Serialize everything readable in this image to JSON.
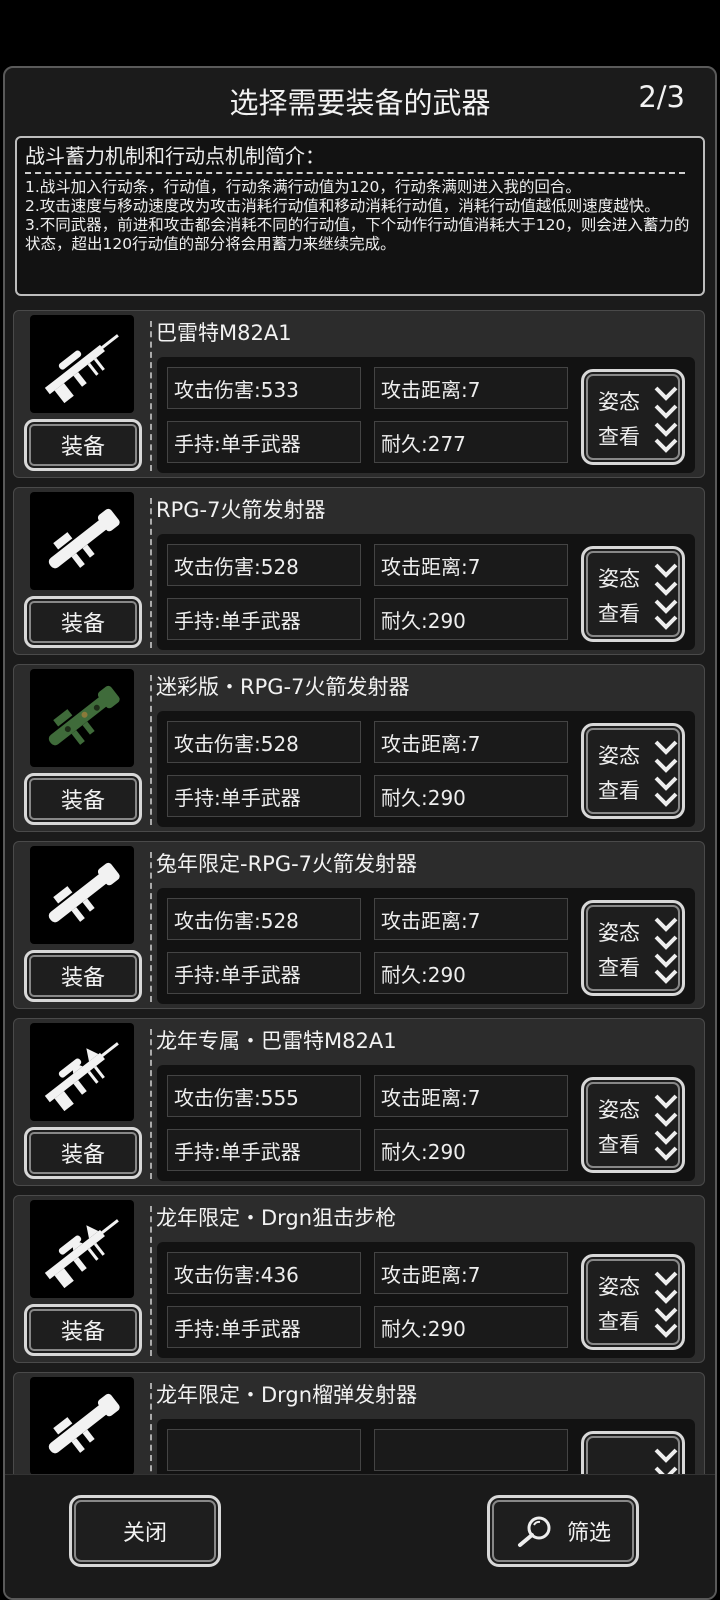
{
  "header": {
    "title": "选择需要装备的武器",
    "page": "2/3"
  },
  "intro": {
    "title": "战斗蓄力机制和行动点机制简介：",
    "lines": [
      "1.战斗加入行动条，行动值，行动条满行动值为120，行动条满则进入我的回合。",
      "2.攻击速度与移动速度改为攻击消耗行动值和移动消耗行动值，消耗行动值越低则速度越快。",
      "3.不同武器，前进和攻击都会消耗不同的行动值，下个动作行动值消耗大于120，则会进入蓄力的状态，超出120行动值的部分将会用蓄力来继续完成。"
    ]
  },
  "weapons": [
    {
      "name": "巴雷特M82A1",
      "damage": "攻击伤害:533",
      "range": "攻击距离:7",
      "hold": "手持:单手武器",
      "durability": "耐久:277",
      "equip": "装备",
      "posture1": "姿态",
      "posture2": "查看",
      "icon": "sniper-rifle-icon"
    },
    {
      "name": "RPG-7火箭发射器",
      "damage": "攻击伤害:528",
      "range": "攻击距离:7",
      "hold": "手持:单手武器",
      "durability": "耐久:290",
      "equip": "装备",
      "posture1": "姿态",
      "posture2": "查看",
      "icon": "rocket-launcher-icon"
    },
    {
      "name": "迷彩版・RPG-7火箭发射器",
      "damage": "攻击伤害:528",
      "range": "攻击距离:7",
      "hold": "手持:单手武器",
      "durability": "耐久:290",
      "equip": "装备",
      "posture1": "姿态",
      "posture2": "查看",
      "icon": "camo-rocket-launcher-icon"
    },
    {
      "name": "兔年限定-RPG-7火箭发射器",
      "damage": "攻击伤害:528",
      "range": "攻击距离:7",
      "hold": "手持:单手武器",
      "durability": "耐久:290",
      "equip": "装备",
      "posture1": "姿态",
      "posture2": "查看",
      "icon": "rabbit-rocket-launcher-icon"
    },
    {
      "name": "龙年专属・巴雷特M82A1",
      "damage": "攻击伤害:555",
      "range": "攻击距离:7",
      "hold": "手持:单手武器",
      "durability": "耐久:290",
      "equip": "装备",
      "posture1": "姿态",
      "posture2": "查看",
      "icon": "dragon-sniper-rifle-icon"
    },
    {
      "name": "龙年限定・Drgn狙击步枪",
      "damage": "攻击伤害:436",
      "range": "攻击距离:7",
      "hold": "手持:单手武器",
      "durability": "耐久:290",
      "equip": "装备",
      "posture1": "姿态",
      "posture2": "查看",
      "icon": "dragon-sniper-icon"
    },
    {
      "name": "龙年限定・Drgn榴弹发射器",
      "damage": "",
      "range": "",
      "hold": "",
      "durability": "",
      "equip": "",
      "posture1": "",
      "posture2": "",
      "icon": "dragon-grenade-launcher-icon"
    }
  ],
  "footer": {
    "close": "关闭",
    "filter": "筛选"
  }
}
